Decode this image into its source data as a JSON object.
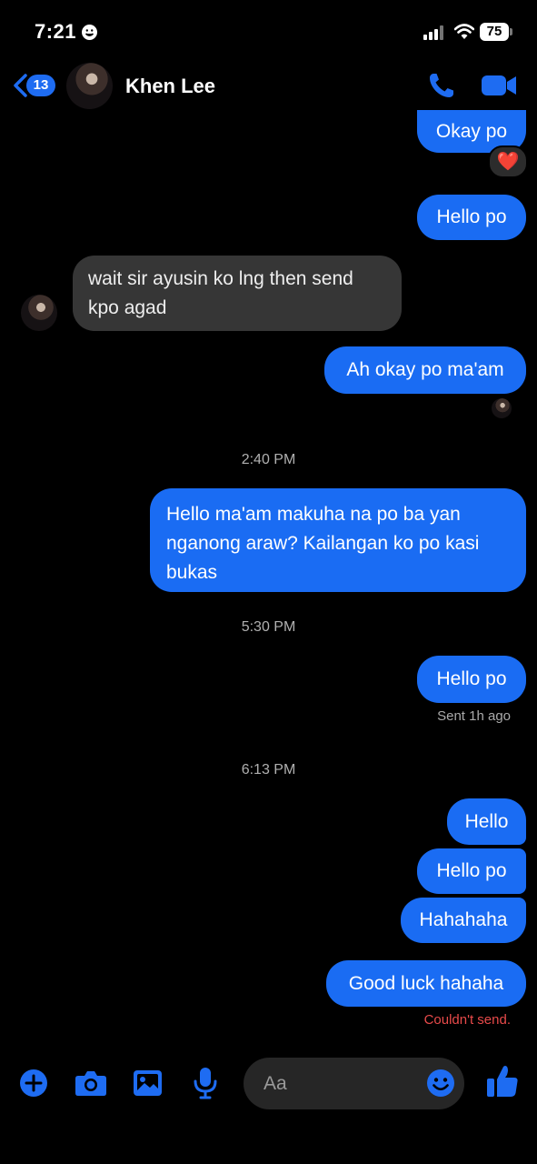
{
  "status_bar": {
    "time": "7:21",
    "battery": "75"
  },
  "header": {
    "back_count": "13",
    "contact_name": "Khen Lee"
  },
  "messages": [
    {
      "text": "Okay po",
      "reaction": "❤️"
    },
    {
      "text": "Hello po"
    },
    {
      "text_line1": "wait sir ayusin ko lng then send",
      "text_line2": "kpo agad"
    },
    {
      "text": "Ah okay po ma'am"
    },
    {
      "text_line1": "Hello ma'am makuha na po ba yan",
      "text_line2": "nganong araw? Kailangan ko po kasi",
      "text_line3": "bukas"
    },
    {
      "text": "Hello po",
      "meta": "Sent 1h ago"
    },
    {
      "text": "Hello"
    },
    {
      "text": "Hello po"
    },
    {
      "text": "Hahahaha"
    },
    {
      "text": "Good luck hahaha",
      "meta": "Couldn't send."
    }
  ],
  "timestamps": [
    "2:40 PM",
    "5:30 PM",
    "6:13 PM"
  ],
  "composer": {
    "placeholder": "Aa"
  },
  "colors": {
    "accent": "#1a6cf3",
    "incoming_bubble": "#363636",
    "error": "#e84a4a"
  }
}
